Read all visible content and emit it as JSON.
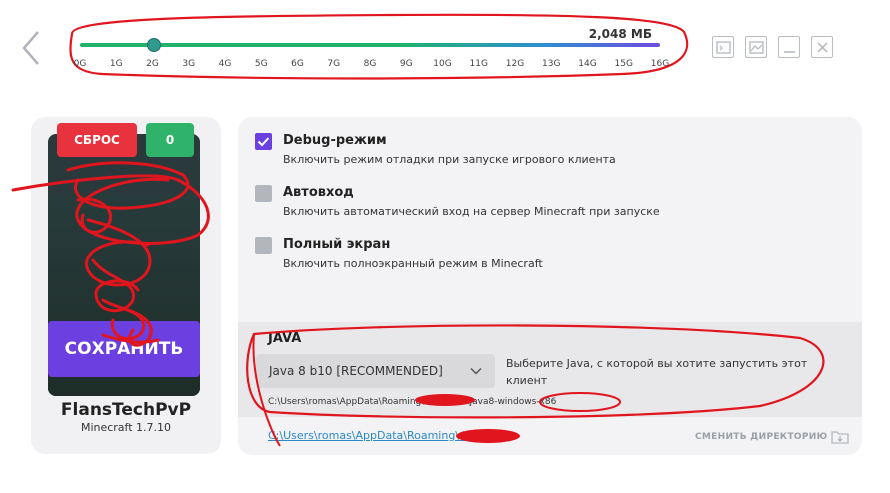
{
  "ram": {
    "value_label": "2,048 МБ",
    "selected_gb": 2,
    "min_gb": 0,
    "max_gb": 16,
    "ticks": [
      "0G",
      "1G",
      "2G",
      "3G",
      "4G",
      "5G",
      "6G",
      "7G",
      "8G",
      "9G",
      "10G",
      "11G",
      "12G",
      "13G",
      "14G",
      "15G",
      "16G"
    ]
  },
  "window": {
    "icons": [
      "console-icon",
      "image-settings-icon",
      "minimize-icon",
      "close-icon"
    ]
  },
  "left": {
    "reset_label": "СБРОС",
    "count_label": "0",
    "save_label": "СОХРАНИТЬ",
    "server_name": "FlansTechPvP",
    "server_version": "Minecraft 1.7.10"
  },
  "options": [
    {
      "title": "Debug-режим",
      "desc": "Включить режим отладки при запуске игрового клиента",
      "checked": true
    },
    {
      "title": "Автовход",
      "desc": "Включить автоматический вход на сервер Minecraft при запуске",
      "checked": false
    },
    {
      "title": "Полный экран",
      "desc": "Включить полноэкранный режим в Minecraft",
      "checked": false
    }
  ],
  "java": {
    "title": "JAVA",
    "selected": "Java 8 b10 [RECOMMENDED]",
    "hint": "Выберите Java, с которой вы хотите запустить этот клиент",
    "path": "C:\\Users\\romas\\AppData\\Roaming\\        \\updates\\java8-windows-x86"
  },
  "directory": {
    "path": "C:\\Users\\romas\\AppData\\Roaming\\        \\updates",
    "change_label": "СМЕНИТЬ ДИРЕКТОРИЮ"
  },
  "colors": {
    "accent": "#6b3fe0",
    "reset": "#e8323e",
    "count": "#2fb36a",
    "link": "#2a89c9",
    "annotation": "#e0151d"
  }
}
